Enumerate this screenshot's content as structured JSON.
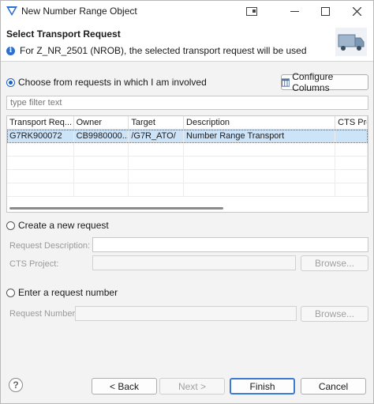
{
  "window": {
    "title": "New Number Range Object"
  },
  "header": {
    "title": "Select Transport Request",
    "message": "For Z_NR_2501 (NROB), the selected transport request will be used"
  },
  "choose": {
    "label": "Choose from requests in which I am involved",
    "configure_label": "Configure Columns",
    "filter_placeholder": "type filter text"
  },
  "table": {
    "headers": [
      "Transport Req...",
      "Owner",
      "Target",
      "Description",
      "CTS Proj"
    ],
    "rows": [
      [
        "G7RK900072",
        "CB9980000...",
        "/G7R_ATO/",
        "Number Range Transport",
        ""
      ]
    ]
  },
  "create": {
    "label": "Create a new request",
    "description_label": "Request Description: *",
    "project_label": "CTS Project:",
    "browse_label": "Browse..."
  },
  "enter": {
    "label": "Enter a request number",
    "number_label": "Request Number:",
    "browse_label": "Browse..."
  },
  "footer": {
    "help_icon": "?",
    "back_label": "< Back",
    "next_label": "Next >",
    "finish_label": "Finish",
    "cancel_label": "Cancel"
  },
  "colors": {
    "accent": "#1f5fbf",
    "selection": "#cde3f8"
  }
}
